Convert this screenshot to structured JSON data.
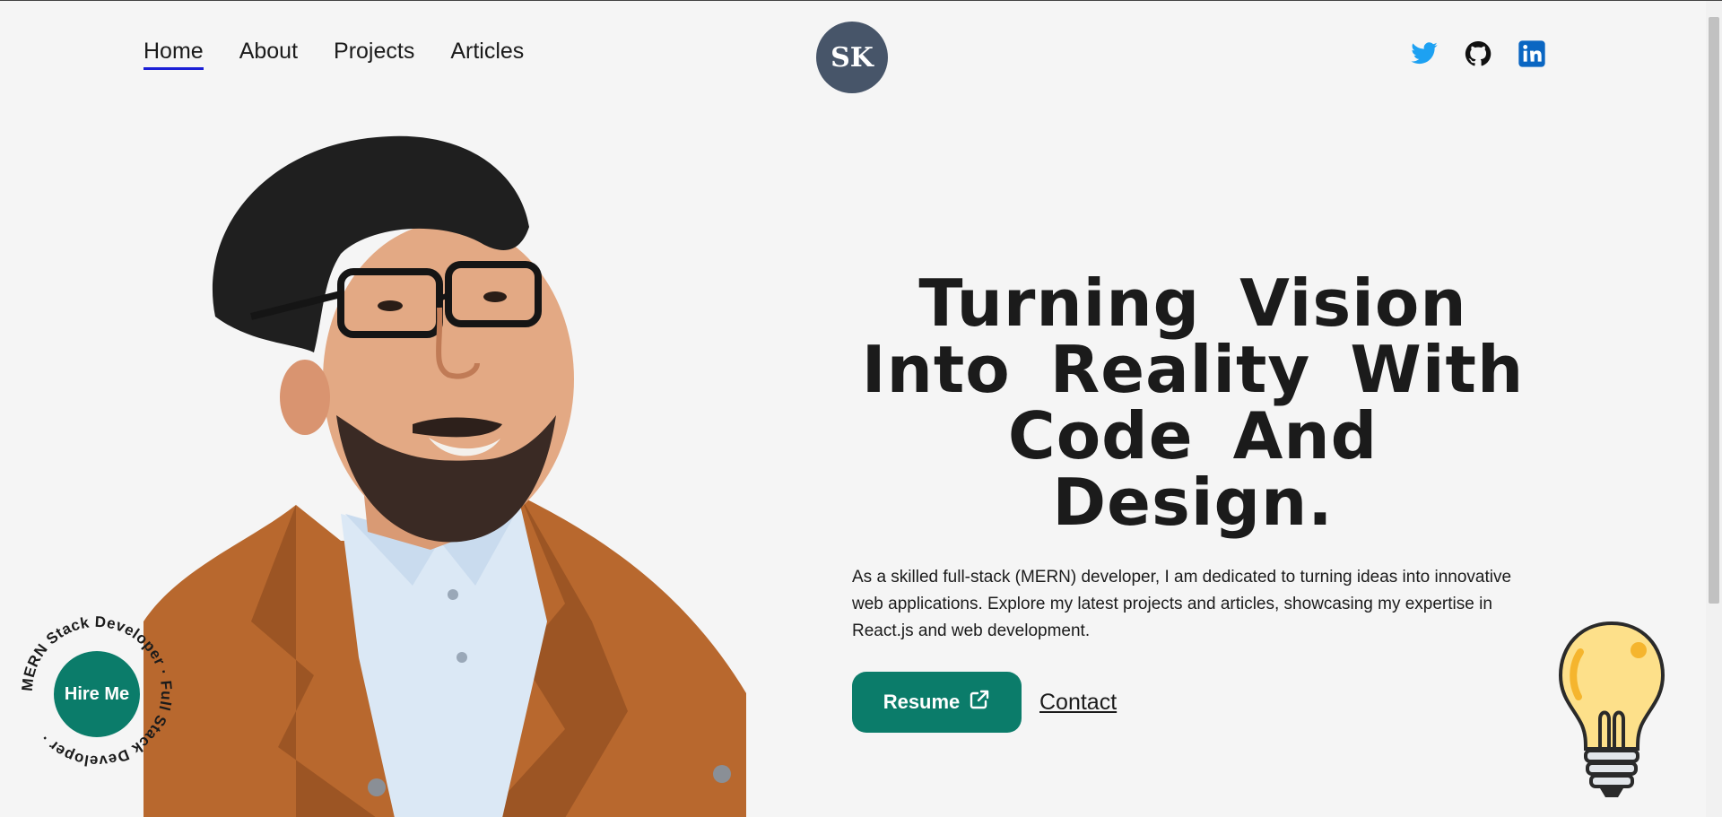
{
  "nav": {
    "items": [
      "Home",
      "About",
      "Projects",
      "Articles"
    ],
    "active": "Home"
  },
  "logo": {
    "text": "SK"
  },
  "social": {
    "icons": [
      "twitter-icon",
      "github-icon",
      "linkedin-icon"
    ],
    "colors": {
      "twitter": "#1da1f2",
      "github": "#111111",
      "linkedin": "#0a66c2"
    }
  },
  "hero": {
    "heading": "Turning Vision Into Reality With Code And Design.",
    "description": "As a skilled full-stack (MERN) developer, I am dedicated to turning ideas into innovative web applications. Explore my latest projects and articles, showcasing my expertise in React.js and web development.",
    "resume_label": "Resume",
    "contact_label": "Contact"
  },
  "hire": {
    "label": "Hire Me",
    "ring_text": "MERN Stack Developer · Full Stack Developer ·"
  },
  "theme": {
    "accent": "#0b7c6a",
    "logo_bg": "#475569",
    "active_underline": "#1b1fd6",
    "background": "#f5f5f5"
  }
}
